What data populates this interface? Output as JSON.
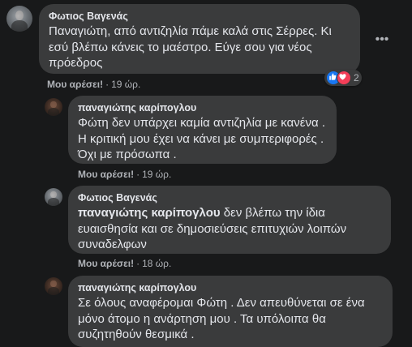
{
  "comments": [
    {
      "author": "Φωτιος Βαγενάς",
      "text": "Παναγιώτη, από αντιζηλία πάμε καλά στις Σέρρες. Κι εσύ βλέπω κάνεις το μαέστρο. Εύγε σου για νέος πρόεδρος",
      "like_label": "Μου αρέσει!",
      "time": "19 ώρ.",
      "reaction_count": "2",
      "reaction_icons": [
        "like-icon",
        "love-icon"
      ],
      "more_icon": "ellipsis-icon"
    },
    {
      "author": "παναγιώτης καρίπογλου",
      "text": "Φώτη δεν υπάρχει καμία αντιζηλία με κανένα . Η κριτική μου έχει να κάνει με συμπεριφορές . Όχι με πρόσωπα .",
      "like_label": "Μου αρέσει!",
      "time": "19 ώρ."
    },
    {
      "author": "Φωτιος Βαγενάς",
      "mention": "παναγιώτης καρίπογλου",
      "text": " δεν βλέπω την ίδια ευαισθησία και σε δημοσιεύσεις επιτυχιών λοιπών συναδελφων",
      "like_label": "Μου αρέσει!",
      "time": "18 ώρ."
    },
    {
      "author": "παναγιώτης καρίπογλου",
      "text": "Σε όλους αναφέρομαι Φώτη . Δεν απευθύνεται σε ένα μόνο άτομο η ανάρτηση μου . Τα υπόλοιπα θα συζητηθούν θεσμικά ."
    }
  ],
  "separator": "·",
  "colors": {
    "background": "#18191a",
    "bubble": "#3a3b3c",
    "text": "#e4e6eb",
    "secondary": "#b0b3b8",
    "like_blue": "#1877f2",
    "love_red": "#f33e58"
  }
}
